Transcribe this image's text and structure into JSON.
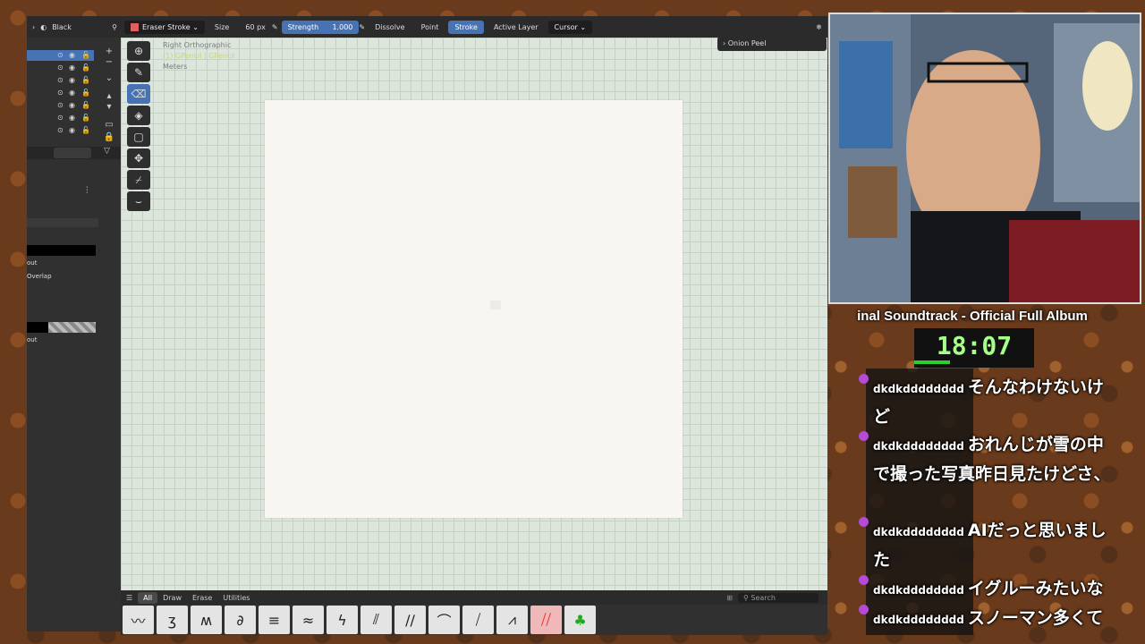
{
  "outliner": {
    "title": "Black",
    "rows": 7
  },
  "properties": {
    "item1": "out",
    "item2": "Overlap",
    "item3": "out"
  },
  "header": {
    "tool": "Eraser Stroke",
    "size_label": "Size",
    "size_value": "60 px",
    "strength_label": "Strength",
    "strength_value": "1.000",
    "mode": "Dissolve",
    "point": "Point",
    "stroke": "Stroke",
    "active_layer": "Active Layer",
    "cursor": "Cursor"
  },
  "viewport": {
    "view_name": "Right Orthographic",
    "object": "(1) GPencil | GPencil",
    "units": "Meters",
    "onion": "Onion Peel"
  },
  "shelf": {
    "tabs": [
      "All",
      "Draw",
      "Erase",
      "Utilities"
    ],
    "search_placeholder": "Search"
  },
  "stream": {
    "now_playing": "inal Soundtrack - Official Full Album",
    "timer": "18:07"
  },
  "chat": [
    {
      "user": "dkdkdddddddd",
      "text": "そんなわけないけど"
    },
    {
      "user": "dkdkdddddddd",
      "text": "おれんじが雪の中で撮った写真昨日見たけどさ、"
    },
    {
      "user": "dkdkdddddddd",
      "text": "AIだっと思いました"
    },
    {
      "user": "dkdkdddddddd",
      "text": "イグルーみたいな"
    },
    {
      "user": "dkdkdddddddd",
      "text": "スノーマン多くて"
    }
  ],
  "colors": {
    "accent": "#4772b3",
    "timer_text": "#a6ff8a",
    "chat_badge": "#b34ad8"
  }
}
